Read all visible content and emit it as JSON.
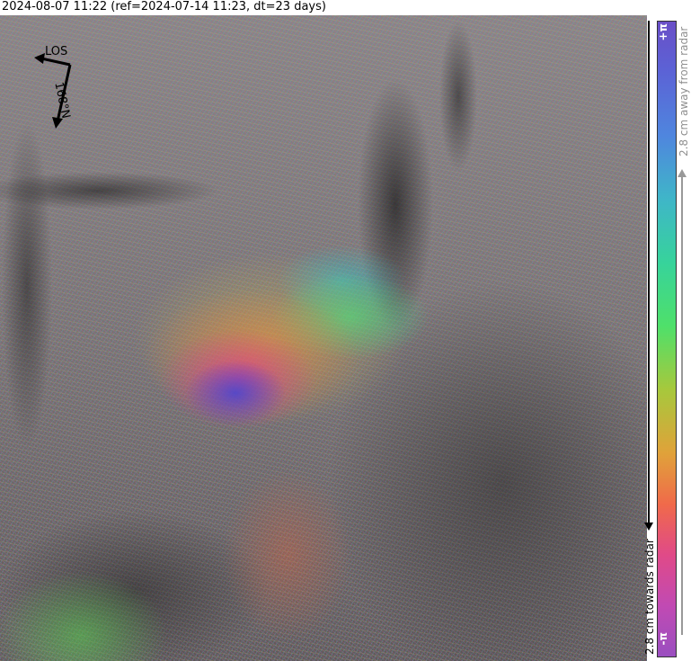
{
  "title": "2024-08-07 11:22 (ref=2024-07-14 11:23, dt=23 days)",
  "compass": {
    "los_label": "LOS",
    "north_label": "N",
    "heading_label": "168°"
  },
  "colorbar": {
    "top_label": "+π",
    "bottom_label": "-π",
    "away_label": "2.8 cm away from radar",
    "toward_label": "2.8 cm towards radar"
  }
}
